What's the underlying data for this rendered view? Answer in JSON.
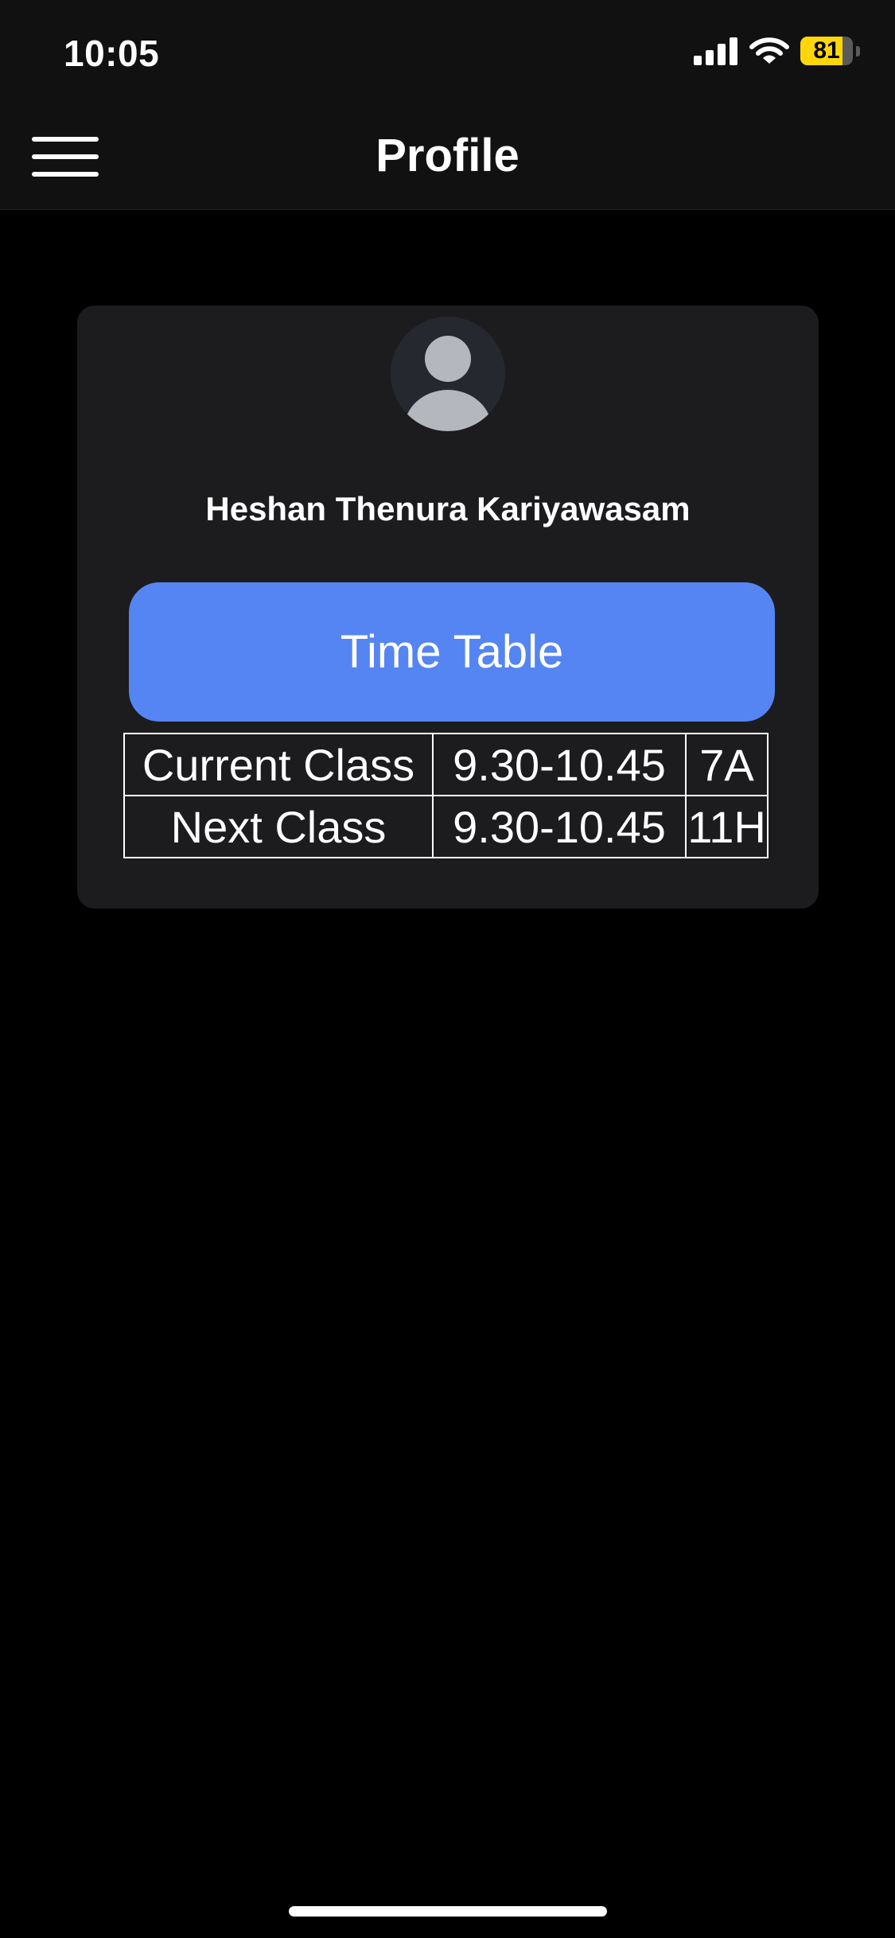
{
  "status_bar": {
    "time": "10:05",
    "battery_level": "81",
    "battery_fraction": 0.81,
    "battery_color": "#ffd60a",
    "icons": [
      "signal-icon",
      "wifi-icon",
      "battery-icon"
    ]
  },
  "header": {
    "title": "Profile",
    "menu_icon": "hamburger-menu-icon"
  },
  "profile": {
    "avatar_icon": "user-avatar-icon",
    "name": "Heshan Thenura Kariyawasam",
    "timetable_button_label": "Time Table",
    "accent_color": "#5585f2"
  },
  "classes": {
    "rows": [
      {
        "label": "Current Class",
        "time": "9.30-10.45",
        "class": "7A"
      },
      {
        "label": "Next Class",
        "time": "9.30-10.45",
        "class": "11H"
      }
    ]
  }
}
